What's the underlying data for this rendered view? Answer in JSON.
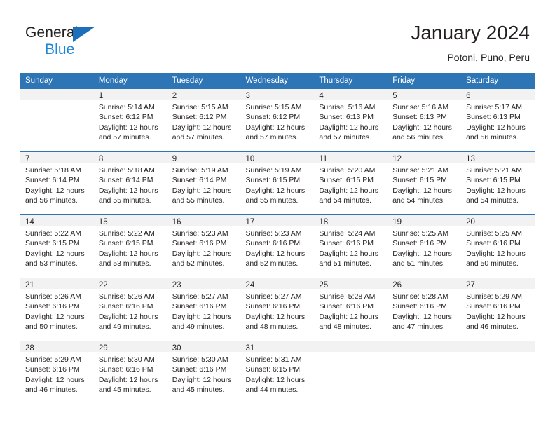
{
  "brand": {
    "line1": "General",
    "line2": "Blue",
    "triangle_color": "#1c6fba",
    "blue_text_color": "#1c86d8"
  },
  "header": {
    "title": "January 2024",
    "subtitle": "Potoni, Puno, Peru"
  },
  "theme": {
    "header_bg": "#2e75b6",
    "daynum_bg": "#f2f2f2",
    "text": "#231f20"
  },
  "weekday_headers": [
    "Sunday",
    "Monday",
    "Tuesday",
    "Wednesday",
    "Thursday",
    "Friday",
    "Saturday"
  ],
  "weeks": [
    [
      {
        "day": "",
        "sunrise": "",
        "sunset": "",
        "daylight_1": "",
        "daylight_2": ""
      },
      {
        "day": "1",
        "sunrise": "Sunrise: 5:14 AM",
        "sunset": "Sunset: 6:12 PM",
        "daylight_1": "Daylight: 12 hours",
        "daylight_2": "and 57 minutes."
      },
      {
        "day": "2",
        "sunrise": "Sunrise: 5:15 AM",
        "sunset": "Sunset: 6:12 PM",
        "daylight_1": "Daylight: 12 hours",
        "daylight_2": "and 57 minutes."
      },
      {
        "day": "3",
        "sunrise": "Sunrise: 5:15 AM",
        "sunset": "Sunset: 6:12 PM",
        "daylight_1": "Daylight: 12 hours",
        "daylight_2": "and 57 minutes."
      },
      {
        "day": "4",
        "sunrise": "Sunrise: 5:16 AM",
        "sunset": "Sunset: 6:13 PM",
        "daylight_1": "Daylight: 12 hours",
        "daylight_2": "and 57 minutes."
      },
      {
        "day": "5",
        "sunrise": "Sunrise: 5:16 AM",
        "sunset": "Sunset: 6:13 PM",
        "daylight_1": "Daylight: 12 hours",
        "daylight_2": "and 56 minutes."
      },
      {
        "day": "6",
        "sunrise": "Sunrise: 5:17 AM",
        "sunset": "Sunset: 6:13 PM",
        "daylight_1": "Daylight: 12 hours",
        "daylight_2": "and 56 minutes."
      }
    ],
    [
      {
        "day": "7",
        "sunrise": "Sunrise: 5:18 AM",
        "sunset": "Sunset: 6:14 PM",
        "daylight_1": "Daylight: 12 hours",
        "daylight_2": "and 56 minutes."
      },
      {
        "day": "8",
        "sunrise": "Sunrise: 5:18 AM",
        "sunset": "Sunset: 6:14 PM",
        "daylight_1": "Daylight: 12 hours",
        "daylight_2": "and 55 minutes."
      },
      {
        "day": "9",
        "sunrise": "Sunrise: 5:19 AM",
        "sunset": "Sunset: 6:14 PM",
        "daylight_1": "Daylight: 12 hours",
        "daylight_2": "and 55 minutes."
      },
      {
        "day": "10",
        "sunrise": "Sunrise: 5:19 AM",
        "sunset": "Sunset: 6:15 PM",
        "daylight_1": "Daylight: 12 hours",
        "daylight_2": "and 55 minutes."
      },
      {
        "day": "11",
        "sunrise": "Sunrise: 5:20 AM",
        "sunset": "Sunset: 6:15 PM",
        "daylight_1": "Daylight: 12 hours",
        "daylight_2": "and 54 minutes."
      },
      {
        "day": "12",
        "sunrise": "Sunrise: 5:21 AM",
        "sunset": "Sunset: 6:15 PM",
        "daylight_1": "Daylight: 12 hours",
        "daylight_2": "and 54 minutes."
      },
      {
        "day": "13",
        "sunrise": "Sunrise: 5:21 AM",
        "sunset": "Sunset: 6:15 PM",
        "daylight_1": "Daylight: 12 hours",
        "daylight_2": "and 54 minutes."
      }
    ],
    [
      {
        "day": "14",
        "sunrise": "Sunrise: 5:22 AM",
        "sunset": "Sunset: 6:15 PM",
        "daylight_1": "Daylight: 12 hours",
        "daylight_2": "and 53 minutes."
      },
      {
        "day": "15",
        "sunrise": "Sunrise: 5:22 AM",
        "sunset": "Sunset: 6:15 PM",
        "daylight_1": "Daylight: 12 hours",
        "daylight_2": "and 53 minutes."
      },
      {
        "day": "16",
        "sunrise": "Sunrise: 5:23 AM",
        "sunset": "Sunset: 6:16 PM",
        "daylight_1": "Daylight: 12 hours",
        "daylight_2": "and 52 minutes."
      },
      {
        "day": "17",
        "sunrise": "Sunrise: 5:23 AM",
        "sunset": "Sunset: 6:16 PM",
        "daylight_1": "Daylight: 12 hours",
        "daylight_2": "and 52 minutes."
      },
      {
        "day": "18",
        "sunrise": "Sunrise: 5:24 AM",
        "sunset": "Sunset: 6:16 PM",
        "daylight_1": "Daylight: 12 hours",
        "daylight_2": "and 51 minutes."
      },
      {
        "day": "19",
        "sunrise": "Sunrise: 5:25 AM",
        "sunset": "Sunset: 6:16 PM",
        "daylight_1": "Daylight: 12 hours",
        "daylight_2": "and 51 minutes."
      },
      {
        "day": "20",
        "sunrise": "Sunrise: 5:25 AM",
        "sunset": "Sunset: 6:16 PM",
        "daylight_1": "Daylight: 12 hours",
        "daylight_2": "and 50 minutes."
      }
    ],
    [
      {
        "day": "21",
        "sunrise": "Sunrise: 5:26 AM",
        "sunset": "Sunset: 6:16 PM",
        "daylight_1": "Daylight: 12 hours",
        "daylight_2": "and 50 minutes."
      },
      {
        "day": "22",
        "sunrise": "Sunrise: 5:26 AM",
        "sunset": "Sunset: 6:16 PM",
        "daylight_1": "Daylight: 12 hours",
        "daylight_2": "and 49 minutes."
      },
      {
        "day": "23",
        "sunrise": "Sunrise: 5:27 AM",
        "sunset": "Sunset: 6:16 PM",
        "daylight_1": "Daylight: 12 hours",
        "daylight_2": "and 49 minutes."
      },
      {
        "day": "24",
        "sunrise": "Sunrise: 5:27 AM",
        "sunset": "Sunset: 6:16 PM",
        "daylight_1": "Daylight: 12 hours",
        "daylight_2": "and 48 minutes."
      },
      {
        "day": "25",
        "sunrise": "Sunrise: 5:28 AM",
        "sunset": "Sunset: 6:16 PM",
        "daylight_1": "Daylight: 12 hours",
        "daylight_2": "and 48 minutes."
      },
      {
        "day": "26",
        "sunrise": "Sunrise: 5:28 AM",
        "sunset": "Sunset: 6:16 PM",
        "daylight_1": "Daylight: 12 hours",
        "daylight_2": "and 47 minutes."
      },
      {
        "day": "27",
        "sunrise": "Sunrise: 5:29 AM",
        "sunset": "Sunset: 6:16 PM",
        "daylight_1": "Daylight: 12 hours",
        "daylight_2": "and 46 minutes."
      }
    ],
    [
      {
        "day": "28",
        "sunrise": "Sunrise: 5:29 AM",
        "sunset": "Sunset: 6:16 PM",
        "daylight_1": "Daylight: 12 hours",
        "daylight_2": "and 46 minutes."
      },
      {
        "day": "29",
        "sunrise": "Sunrise: 5:30 AM",
        "sunset": "Sunset: 6:16 PM",
        "daylight_1": "Daylight: 12 hours",
        "daylight_2": "and 45 minutes."
      },
      {
        "day": "30",
        "sunrise": "Sunrise: 5:30 AM",
        "sunset": "Sunset: 6:16 PM",
        "daylight_1": "Daylight: 12 hours",
        "daylight_2": "and 45 minutes."
      },
      {
        "day": "31",
        "sunrise": "Sunrise: 5:31 AM",
        "sunset": "Sunset: 6:15 PM",
        "daylight_1": "Daylight: 12 hours",
        "daylight_2": "and 44 minutes."
      },
      {
        "day": "",
        "sunrise": "",
        "sunset": "",
        "daylight_1": "",
        "daylight_2": ""
      },
      {
        "day": "",
        "sunrise": "",
        "sunset": "",
        "daylight_1": "",
        "daylight_2": ""
      },
      {
        "day": "",
        "sunrise": "",
        "sunset": "",
        "daylight_1": "",
        "daylight_2": ""
      }
    ]
  ]
}
